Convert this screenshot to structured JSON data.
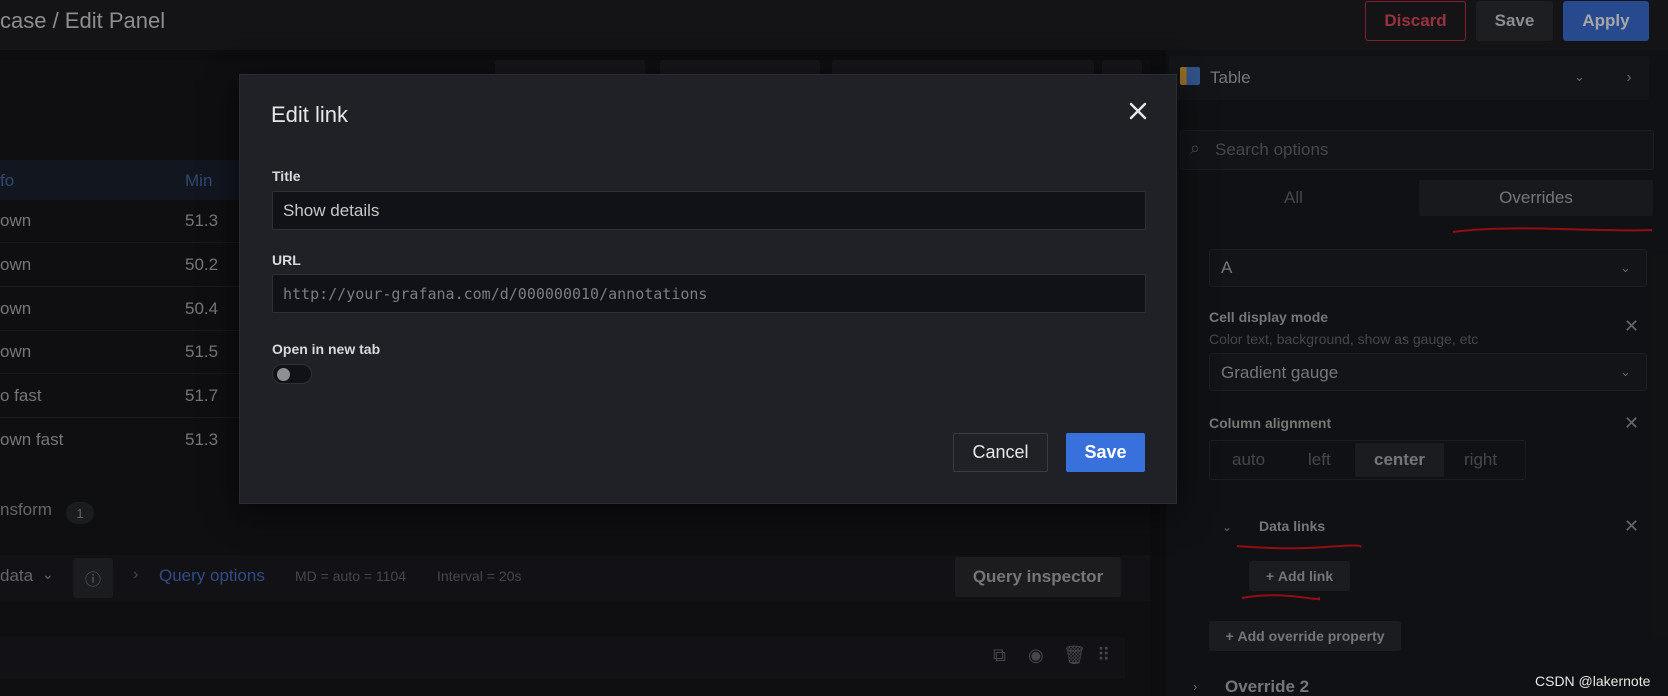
{
  "header": {
    "page_title": "case / Edit Panel",
    "discard_label": "Discard",
    "save_label": "Save",
    "apply_label": "Apply"
  },
  "table": {
    "header_first": "fo",
    "header_min": "Min",
    "rows": [
      {
        "info": "own",
        "min": "51.3"
      },
      {
        "info": "own",
        "min": "50.2"
      },
      {
        "info": "own",
        "min": "50.4"
      },
      {
        "info": "own",
        "min": "51.5"
      },
      {
        "info": "o fast",
        "min": "51.7"
      },
      {
        "info": "own fast",
        "min": "51.3"
      }
    ]
  },
  "transform": {
    "label": "nsform",
    "count": "1"
  },
  "query_bar": {
    "datasource": "data",
    "options_label": "Query options",
    "md": "MD = auto = 1104",
    "interval": "Interval = 20s",
    "inspector_label": "Query inspector"
  },
  "options_pane": {
    "visualization": "Table",
    "search_placeholder": "Search options",
    "tabs": [
      "All",
      "Overrides"
    ],
    "active_tab": "Overrides",
    "field_selector": "A",
    "cell_display": {
      "title": "Cell display mode",
      "description": "Color text, background, show as gauge, etc",
      "value": "Gradient gauge"
    },
    "column_alignment": {
      "title": "Column alignment",
      "options": [
        "auto",
        "left",
        "center",
        "right"
      ],
      "selected": "center"
    },
    "data_links": {
      "title": "Data links",
      "add_link_label": "Add link"
    },
    "add_override_label": "Add override property",
    "override2_label": "Override 2"
  },
  "modal": {
    "title": "Edit link",
    "title_label": "Title",
    "title_value": "Show details",
    "url_label": "URL",
    "url_value": "http://your-grafana.com/d/000000010/annotations",
    "new_tab_label": "Open in new tab",
    "new_tab_enabled": false,
    "cancel_label": "Cancel",
    "save_label": "Save"
  },
  "watermark": "CSDN @lakernote",
  "colors": {
    "accent": "#3871dc",
    "danger": "#e84d64",
    "annotation": "#e0161e"
  }
}
